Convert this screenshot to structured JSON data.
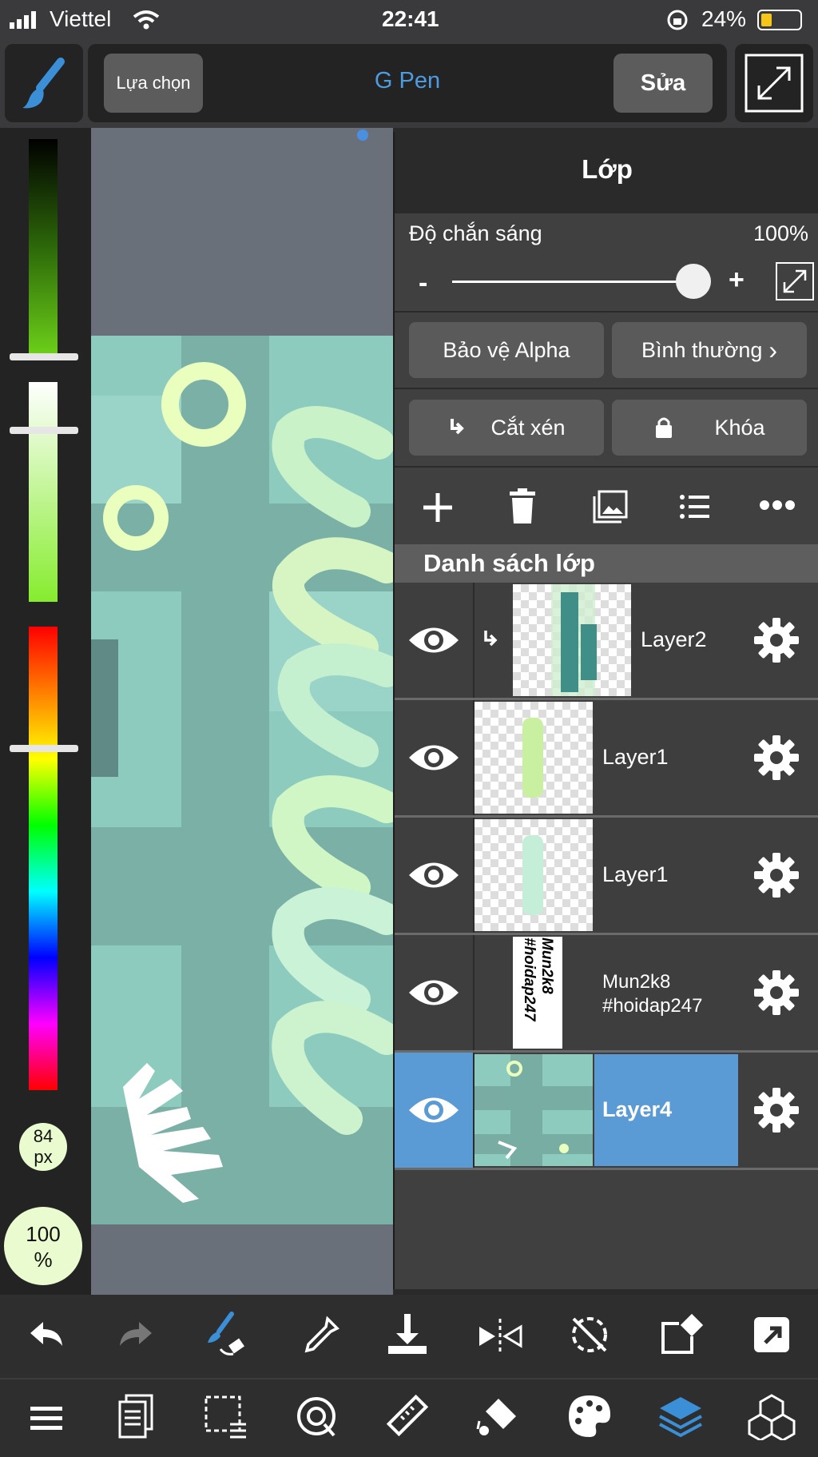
{
  "status_bar": {
    "carrier": "Viettel",
    "time": "22:41",
    "battery": "24%"
  },
  "toolbar": {
    "selection_label": "Lựa chọn",
    "brush_name": "G Pen",
    "edit_label": "Sửa"
  },
  "left_panel": {
    "brush_size": "84",
    "brush_size_unit": "px",
    "opacity": "100",
    "opacity_unit": "%"
  },
  "layer_panel": {
    "title": "Lớp",
    "opacity_label": "Độ chắn sáng",
    "opacity_value": "100%",
    "opacity_fraction": 1.0,
    "minus": "-",
    "plus": "+",
    "alpha_protect_label": "Bảo vệ Alpha",
    "blend_mode_label": "Bình thường",
    "clip_label": "Cắt xén",
    "lock_label": "Khóa",
    "list_header": "Danh sách lớp",
    "layers": [
      {
        "name": "Layer2",
        "clipped": true,
        "selected": false
      },
      {
        "name": "Layer1",
        "clipped": false,
        "selected": false
      },
      {
        "name": "Layer1",
        "clipped": false,
        "selected": false
      },
      {
        "name": "Mun2k8\n#hoidap247",
        "thumb_text": "Mun2k8\n#hoidap247",
        "clipped": false,
        "selected": false
      },
      {
        "name": "Layer4",
        "clipped": false,
        "selected": true
      }
    ]
  },
  "colors": {
    "accent_blue": "#5b9bd5",
    "selected_layer": "#5b9bd5",
    "canvas_teal": "#8ecbbf",
    "panel": "#404040"
  },
  "icons": {
    "bottom_row_1": [
      "undo-icon",
      "redo-icon",
      "brush-swap-icon",
      "eyedropper-icon",
      "download-icon",
      "flip-icon",
      "rotate-reset-icon",
      "transform-icon",
      "share-icon"
    ],
    "bottom_row_2": [
      "menu-icon",
      "pages-icon",
      "selection-icon",
      "lasso-icon",
      "ruler-icon",
      "fill-icon",
      "palette-icon",
      "layers-icon",
      "materials-icon"
    ]
  }
}
